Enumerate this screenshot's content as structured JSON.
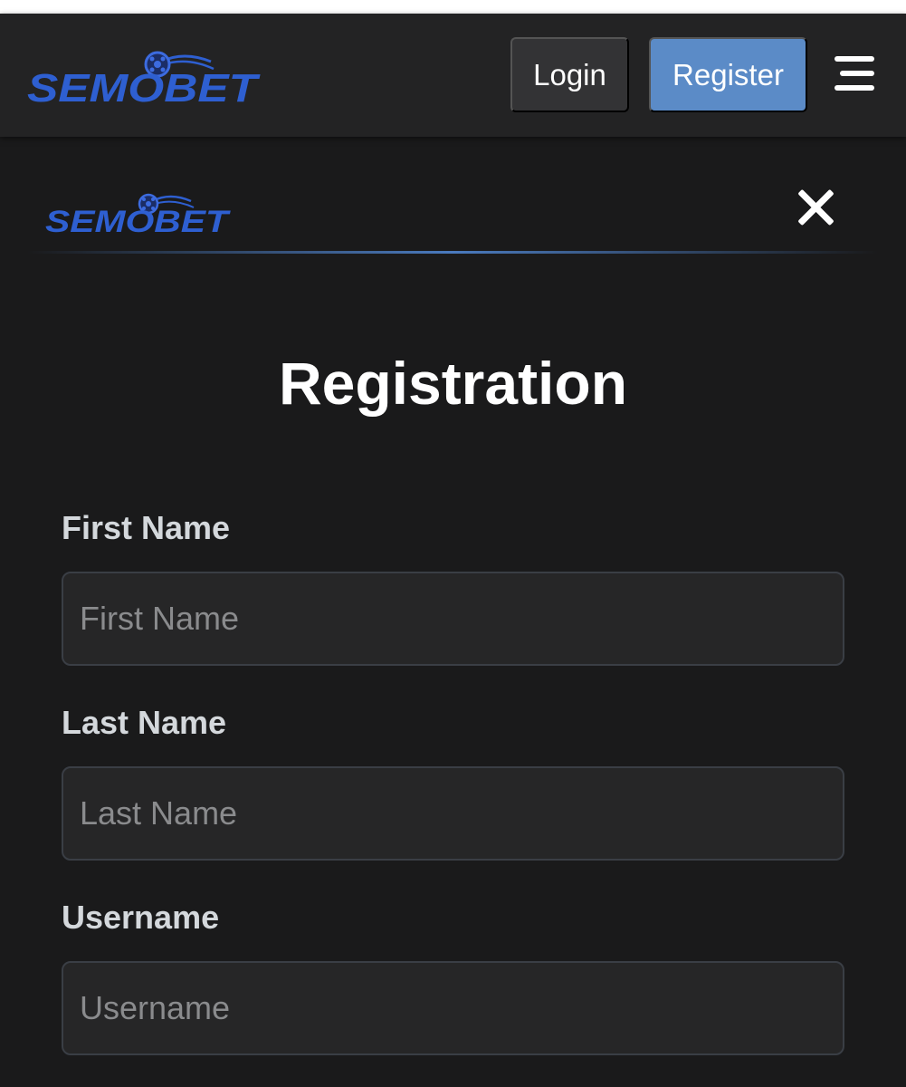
{
  "brand": {
    "logo_text": "SEMOBET",
    "logo_color": "#2e5fd1",
    "accent_color": "#5b8bc7"
  },
  "navbar": {
    "login_label": "Login",
    "register_label": "Register",
    "menu_icon": "hamburger-icon"
  },
  "modal": {
    "close_icon": "close-icon",
    "title": "Registration",
    "fields": [
      {
        "label": "First Name",
        "placeholder": "First Name",
        "value": ""
      },
      {
        "label": "Last Name",
        "placeholder": "Last Name",
        "value": ""
      },
      {
        "label": "Username",
        "placeholder": "Username",
        "value": ""
      }
    ]
  }
}
